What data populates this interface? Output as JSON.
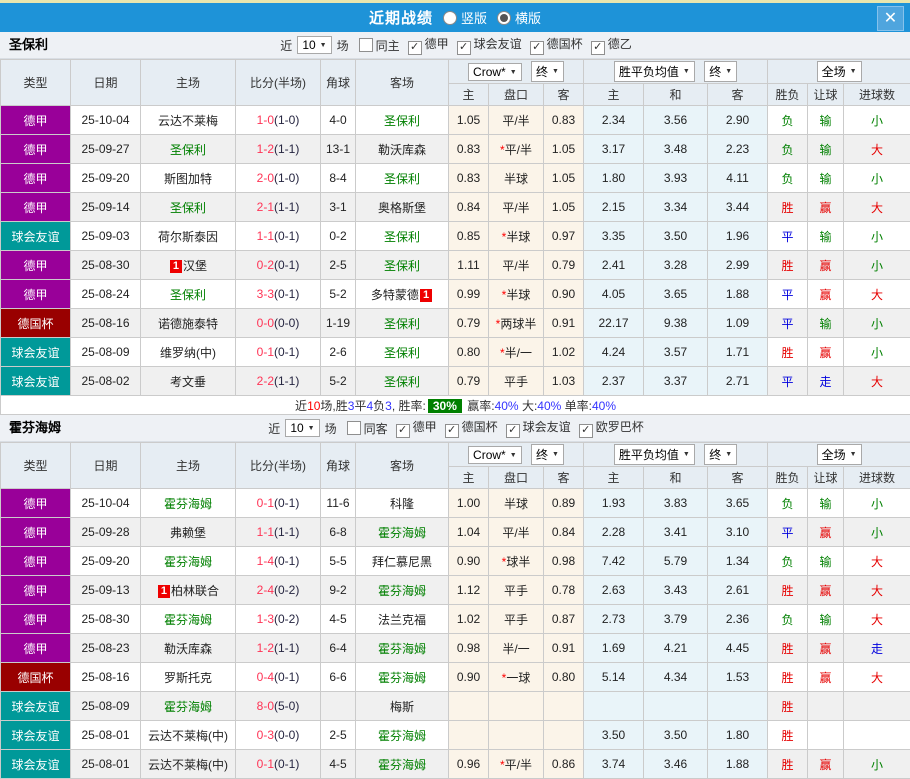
{
  "icons": {
    "close": "✕",
    "dropdown_arrow": "▼",
    "checkmark": "✓"
  },
  "colors": {
    "titlebar_blue": "#1E93D8",
    "league_bundesliga": "#990099",
    "league_friendly": "#009999",
    "league_dfb_pokal": "#990000",
    "win_red": "#E60000",
    "draw_blue": "#0000DD",
    "loss_green": "#008000",
    "score_red": "#FF3355",
    "odds_bg": "#FBF4E9",
    "avg_bg": "#E9F4F9"
  },
  "league_colors": {
    "德甲": "#990099",
    "球会友谊": "#009999",
    "德国杯": "#990000",
    "德乙": "#990099",
    "欧罗巴杯": "#1E93D8"
  },
  "titlebar": {
    "title": "近期战绩",
    "radio_vertical": "竖版",
    "radio_horizontal": "横版"
  },
  "columns": {
    "type": "类型",
    "date": "日期",
    "home": "主场",
    "score": "比分(半场)",
    "corner": "角球",
    "away": "客场",
    "odds_home": "主",
    "odds_handicap": "盘口",
    "odds_away": "客",
    "avg_home": "主",
    "avg_draw": "和",
    "avg_away": "客",
    "res_wdl": "胜负",
    "res_handicap": "让球",
    "res_goals": "进球数"
  },
  "dropdowns": {
    "bookmaker": "Crow*",
    "final1": "终",
    "avg": "胜平负均值",
    "final2": "终",
    "scope": "全场"
  },
  "sections": [
    {
      "team": "圣保利",
      "filters": {
        "near_label": "近",
        "games_value": "10",
        "games_label": "场",
        "same_label": "同主",
        "same_checked": false,
        "leagues": [
          "德甲",
          "球会友谊",
          "德国杯",
          "德乙"
        ]
      },
      "rows": [
        {
          "type": "德甲",
          "date": "25-10-04",
          "home": "云达不莱梅",
          "home_team": false,
          "ft": "1-0",
          "ht": "(1-0)",
          "corner": "4-0",
          "away": "圣保利",
          "away_team": true,
          "odds": [
            "1.05",
            "平/半",
            "0.83"
          ],
          "avg": [
            "2.34",
            "3.56",
            "2.90"
          ],
          "results": [
            "负",
            "输",
            "小"
          ]
        },
        {
          "type": "德甲",
          "date": "25-09-27",
          "home": "圣保利",
          "home_team": true,
          "ft": "1-2",
          "ht": "(1-1)",
          "corner": "13-1",
          "away": "勒沃库森",
          "away_team": false,
          "odds": [
            "0.83",
            "*平/半",
            "1.05"
          ],
          "avg": [
            "3.17",
            "3.48",
            "2.23"
          ],
          "results": [
            "负",
            "输",
            "大"
          ]
        },
        {
          "type": "德甲",
          "date": "25-09-20",
          "home": "斯图加特",
          "home_team": false,
          "ft": "2-0",
          "ht": "(1-0)",
          "corner": "8-4",
          "away": "圣保利",
          "away_team": true,
          "odds": [
            "0.83",
            "半球",
            "1.05"
          ],
          "avg": [
            "1.80",
            "3.93",
            "4.11"
          ],
          "results": [
            "负",
            "输",
            "小"
          ]
        },
        {
          "type": "德甲",
          "date": "25-09-14",
          "home": "圣保利",
          "home_team": true,
          "ft": "2-1",
          "ht": "(1-1)",
          "corner": "3-1",
          "away": "奥格斯堡",
          "away_team": false,
          "odds": [
            "0.84",
            "平/半",
            "1.05"
          ],
          "avg": [
            "2.15",
            "3.34",
            "3.44"
          ],
          "results": [
            "胜",
            "赢",
            "大"
          ]
        },
        {
          "type": "球会友谊",
          "date": "25-09-03",
          "home": "荷尔斯泰因",
          "home_team": false,
          "ft": "1-1",
          "ht": "(0-1)",
          "corner": "0-2",
          "away": "圣保利",
          "away_team": true,
          "odds": [
            "0.85",
            "*半球",
            "0.97"
          ],
          "avg": [
            "3.35",
            "3.50",
            "1.96"
          ],
          "results": [
            "平",
            "输",
            "小"
          ]
        },
        {
          "type": "德甲",
          "date": "25-08-30",
          "home": "汉堡",
          "home_team": false,
          "home_badge": "1",
          "home_badge_pos": "before",
          "ft": "0-2",
          "ht": "(0-1)",
          "corner": "2-5",
          "away": "圣保利",
          "away_team": true,
          "odds": [
            "1.11",
            "平/半",
            "0.79"
          ],
          "avg": [
            "2.41",
            "3.28",
            "2.99"
          ],
          "results": [
            "胜",
            "赢",
            "小"
          ]
        },
        {
          "type": "德甲",
          "date": "25-08-24",
          "home": "圣保利",
          "home_team": true,
          "ft": "3-3",
          "ht": "(0-1)",
          "corner": "5-2",
          "away": "多特蒙德",
          "away_team": false,
          "away_badge": "1",
          "away_badge_pos": "after",
          "odds": [
            "0.99",
            "*半球",
            "0.90"
          ],
          "avg": [
            "4.05",
            "3.65",
            "1.88"
          ],
          "results": [
            "平",
            "赢",
            "大"
          ]
        },
        {
          "type": "德国杯",
          "date": "25-08-16",
          "home": "诺德施泰特",
          "home_team": false,
          "ft": "0-0",
          "ht": "(0-0)",
          "corner": "1-19",
          "away": "圣保利",
          "away_team": true,
          "odds": [
            "0.79",
            "*两球半",
            "0.91"
          ],
          "avg": [
            "22.17",
            "9.38",
            "1.09"
          ],
          "results": [
            "平",
            "输",
            "小"
          ]
        },
        {
          "type": "球会友谊",
          "date": "25-08-09",
          "home": "维罗纳(中)",
          "home_team": false,
          "ft": "0-1",
          "ht": "(0-1)",
          "corner": "2-6",
          "away": "圣保利",
          "away_team": true,
          "odds": [
            "0.80",
            "*半/一",
            "1.02"
          ],
          "avg": [
            "4.24",
            "3.57",
            "1.71"
          ],
          "results": [
            "胜",
            "赢",
            "小"
          ]
        },
        {
          "type": "球会友谊",
          "date": "25-08-02",
          "home": "考文垂",
          "home_team": false,
          "ft": "2-2",
          "ht": "(1-1)",
          "corner": "5-2",
          "away": "圣保利",
          "away_team": true,
          "odds": [
            "0.79",
            "平手",
            "1.03"
          ],
          "avg": [
            "2.37",
            "3.37",
            "2.71"
          ],
          "results": [
            "平",
            "走",
            "大"
          ]
        }
      ],
      "summary": [
        {
          "t": "近",
          "c": "k"
        },
        {
          "t": "10",
          "c": "r"
        },
        {
          "t": "场,胜",
          "c": "k"
        },
        {
          "t": "3",
          "c": "b"
        },
        {
          "t": "平",
          "c": "k"
        },
        {
          "t": "4",
          "c": "b"
        },
        {
          "t": "负",
          "c": "k"
        },
        {
          "t": "3",
          "c": "b"
        },
        {
          "t": ", 胜率:",
          "c": "k"
        },
        {
          "t": "30%",
          "c": "badge"
        },
        {
          "t": " 赢率:",
          "c": "k"
        },
        {
          "t": "40%",
          "c": "b"
        },
        {
          "t": " 大:",
          "c": "k"
        },
        {
          "t": "40%",
          "c": "b"
        },
        {
          "t": " 单率:",
          "c": "k"
        },
        {
          "t": "40%",
          "c": "b"
        }
      ]
    },
    {
      "team": "霍芬海姆",
      "filters": {
        "near_label": "近",
        "games_value": "10",
        "games_label": "场",
        "same_label": "同客",
        "same_checked": false,
        "leagues": [
          "德甲",
          "德国杯",
          "球会友谊",
          "欧罗巴杯"
        ]
      },
      "rows": [
        {
          "type": "德甲",
          "date": "25-10-04",
          "home": "霍芬海姆",
          "home_team": true,
          "ft": "0-1",
          "ht": "(0-1)",
          "corner": "11-6",
          "away": "科隆",
          "away_team": false,
          "odds": [
            "1.00",
            "半球",
            "0.89"
          ],
          "avg": [
            "1.93",
            "3.83",
            "3.65"
          ],
          "results": [
            "负",
            "输",
            "小"
          ]
        },
        {
          "type": "德甲",
          "date": "25-09-28",
          "home": "弗赖堡",
          "home_team": false,
          "ft": "1-1",
          "ht": "(1-1)",
          "corner": "6-8",
          "away": "霍芬海姆",
          "away_team": true,
          "odds": [
            "1.04",
            "平/半",
            "0.84"
          ],
          "avg": [
            "2.28",
            "3.41",
            "3.10"
          ],
          "results": [
            "平",
            "赢",
            "小"
          ]
        },
        {
          "type": "德甲",
          "date": "25-09-20",
          "home": "霍芬海姆",
          "home_team": true,
          "ft": "1-4",
          "ht": "(0-1)",
          "corner": "5-5",
          "away": "拜仁慕尼黑",
          "away_team": false,
          "odds": [
            "0.90",
            "*球半",
            "0.98"
          ],
          "avg": [
            "7.42",
            "5.79",
            "1.34"
          ],
          "results": [
            "负",
            "输",
            "大"
          ]
        },
        {
          "type": "德甲",
          "date": "25-09-13",
          "home": "柏林联合",
          "home_team": false,
          "home_badge": "1",
          "home_badge_pos": "before",
          "ft": "2-4",
          "ht": "(0-2)",
          "corner": "9-2",
          "away": "霍芬海姆",
          "away_team": true,
          "odds": [
            "1.12",
            "平手",
            "0.78"
          ],
          "avg": [
            "2.63",
            "3.43",
            "2.61"
          ],
          "results": [
            "胜",
            "赢",
            "大"
          ]
        },
        {
          "type": "德甲",
          "date": "25-08-30",
          "home": "霍芬海姆",
          "home_team": true,
          "ft": "1-3",
          "ht": "(0-2)",
          "corner": "4-5",
          "away": "法兰克福",
          "away_team": false,
          "odds": [
            "1.02",
            "平手",
            "0.87"
          ],
          "avg": [
            "2.73",
            "3.79",
            "2.36"
          ],
          "results": [
            "负",
            "输",
            "大"
          ]
        },
        {
          "type": "德甲",
          "date": "25-08-23",
          "home": "勒沃库森",
          "home_team": false,
          "ft": "1-2",
          "ht": "(1-1)",
          "corner": "6-4",
          "away": "霍芬海姆",
          "away_team": true,
          "odds": [
            "0.98",
            "半/一",
            "0.91"
          ],
          "avg": [
            "1.69",
            "4.21",
            "4.45"
          ],
          "results": [
            "胜",
            "赢",
            "走"
          ]
        },
        {
          "type": "德国杯",
          "date": "25-08-16",
          "home": "罗斯托克",
          "home_team": false,
          "ft": "0-4",
          "ht": "(0-1)",
          "corner": "6-6",
          "away": "霍芬海姆",
          "away_team": true,
          "odds": [
            "0.90",
            "*一球",
            "0.80"
          ],
          "avg": [
            "5.14",
            "4.34",
            "1.53"
          ],
          "results": [
            "胜",
            "赢",
            "大"
          ]
        },
        {
          "type": "球会友谊",
          "date": "25-08-09",
          "home": "霍芬海姆",
          "home_team": true,
          "ft": "8-0",
          "ht": "(5-0)",
          "corner": "",
          "away": "梅斯",
          "away_team": false,
          "odds": [
            "",
            "",
            ""
          ],
          "avg": [
            "",
            "",
            ""
          ],
          "results": [
            "胜",
            "",
            ""
          ]
        },
        {
          "type": "球会友谊",
          "date": "25-08-01",
          "home": "云达不莱梅(中)",
          "home_team": false,
          "ft": "0-3",
          "ht": "(0-0)",
          "corner": "2-5",
          "away": "霍芬海姆",
          "away_team": true,
          "odds": [
            "",
            "",
            ""
          ],
          "avg": [
            "3.50",
            "3.50",
            "1.80"
          ],
          "results": [
            "胜",
            "",
            ""
          ]
        },
        {
          "type": "球会友谊",
          "date": "25-08-01",
          "home": "云达不莱梅(中)",
          "home_team": false,
          "ft": "0-1",
          "ht": "(0-1)",
          "corner": "4-5",
          "away": "霍芬海姆",
          "away_team": true,
          "odds": [
            "0.96",
            "*平/半",
            "0.86"
          ],
          "avg": [
            "3.74",
            "3.46",
            "1.88"
          ],
          "results": [
            "胜",
            "赢",
            "小"
          ]
        }
      ],
      "summary": null
    }
  ]
}
